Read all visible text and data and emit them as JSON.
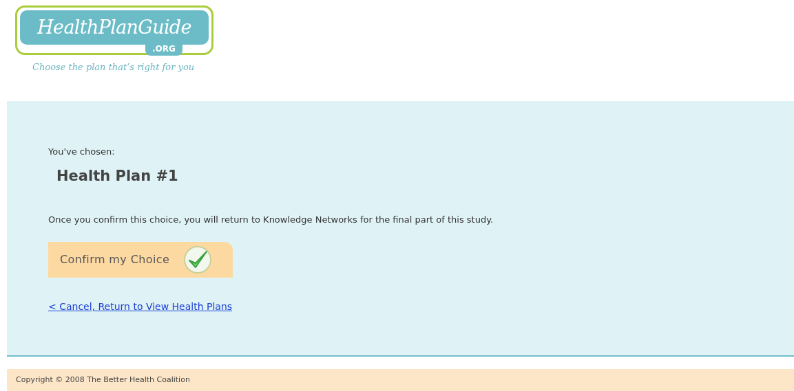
{
  "logo": {
    "name": "HealthPlanGuide",
    "suffix": ".ORG",
    "tagline": "Choose the plan that’s right for you"
  },
  "selection": {
    "label": "You've chosen:",
    "plan": "Health Plan #1",
    "note": "Once you confirm this choice, you will return to Knowledge Networks for the final part of this study.",
    "confirm_button": "Confirm my Choice",
    "cancel_link": "< Cancel, Return to View Health Plans"
  },
  "footer": {
    "copyright": "Copyright © 2008 The Better Health Coalition"
  }
}
